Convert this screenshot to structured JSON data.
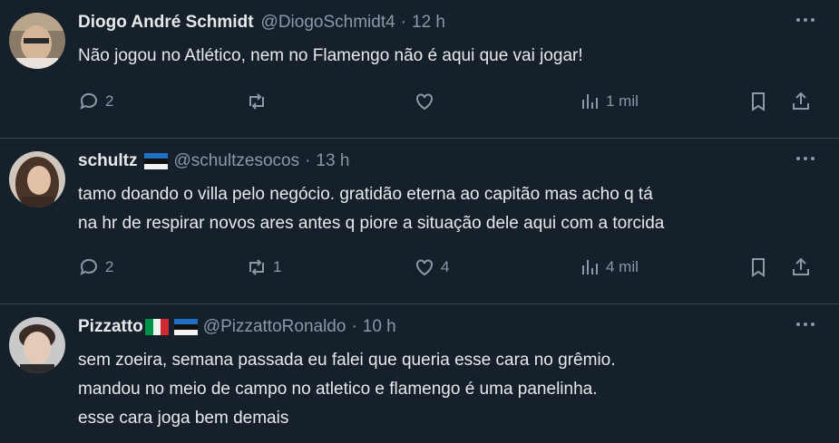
{
  "tweets": [
    {
      "name": "Diogo André Schmidt",
      "handle": "@DiogoSchmidt4",
      "dot": "·",
      "time": "12 h",
      "lines": [
        "Não jogou no Atlético, nem no Flamengo não é aqui que vai jogar!"
      ],
      "replies": "2",
      "retweets": "",
      "likes": "",
      "views": "1 mil"
    },
    {
      "name": "schultz",
      "handle": "@schultzesocos",
      "dot": "·",
      "time": "13 h",
      "lines": [
        "tamo doando o villa pelo negócio. gratidão eterna ao capitão mas acho q tá",
        "na hr de respirar novos ares antes q piore a situação dele aqui com a torcida"
      ],
      "replies": "2",
      "retweets": "1",
      "likes": "4",
      "views": "4 mil"
    },
    {
      "name": "Pizzatto",
      "handle": "@PizzattoRonaldo",
      "dot": "·",
      "time": "10 h",
      "lines": [
        "sem zoeira, semana passada eu falei que queria esse cara no grêmio.",
        "mandou no meio de campo no atletico e flamengo é uma panelinha.",
        "esse cara joga bem demais"
      ]
    }
  ],
  "colors": {
    "bg": "#15202b",
    "text": "#e7e9ea",
    "muted": "#8b98a5",
    "divider": "#38444d"
  },
  "icons": [
    "reply-icon",
    "retweet-icon",
    "like-icon",
    "views-icon",
    "bookmark-icon",
    "share-icon",
    "more-icon",
    "estonia-flag-icon",
    "italy-flag-icon"
  ]
}
